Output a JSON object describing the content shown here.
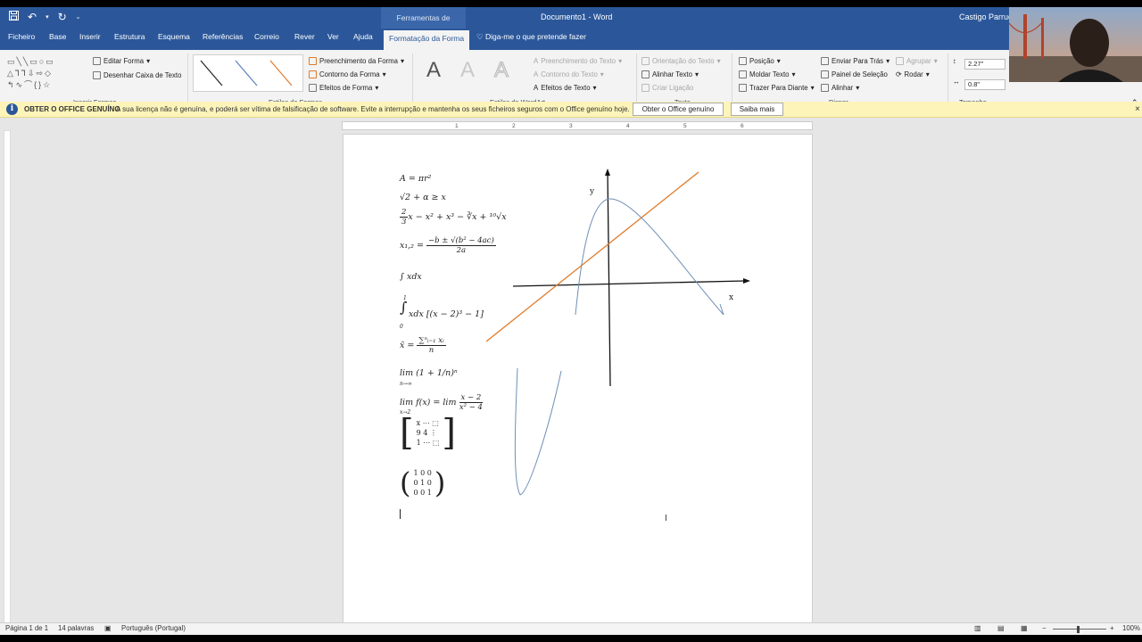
{
  "title_bar": {
    "contextual_header": "Ferramentas de Desenho",
    "document_title": "Documento1 - Word",
    "user_name": "Castigo Parruque"
  },
  "tabs": [
    "Ficheiro",
    "Base",
    "Inserir",
    "Estrutura",
    "Esquema",
    "Referências",
    "Correio",
    "Rever",
    "Ver",
    "Ajuda",
    "Formatação da Forma"
  ],
  "tell_me": "Diga-me o que pretende fazer",
  "ribbon": {
    "insert_shapes": {
      "edit_shape": "Editar Forma",
      "draw_textbox": "Desenhar Caixa de Texto",
      "label": "Inserir Formas"
    },
    "shape_styles": {
      "fill": "Preenchimento da Forma",
      "outline": "Contorno da Forma",
      "effects": "Efeitos de Forma",
      "label": "Estilos de Formas"
    },
    "wordart_styles": {
      "letter": "A",
      "text_fill": "Preenchimento do Texto",
      "text_outline": "Contorno do Texto",
      "text_effects": "Efeitos de Texto",
      "label": "Estilos do WordArt"
    },
    "text": {
      "direction": "Orientação do Texto",
      "align": "Alinhar Texto",
      "link": "Criar Ligação",
      "label": "Texto"
    },
    "arrange": {
      "position": "Posição",
      "wrap": "Moldar Texto",
      "bring_forward": "Trazer Para Diante",
      "send_backward": "Enviar Para Trás",
      "selection_pane": "Painel de Seleção",
      "align": "Alinhar",
      "group": "Agrupar",
      "rotate": "Rodar",
      "label": "Dispor"
    },
    "size": {
      "height": "2.27\"",
      "width": "0.8\"",
      "label": "Tamanho"
    }
  },
  "message_bar": {
    "title": "OBTER O OFFICE GENUÍNO",
    "text": "A sua licença não é genuína, e poderá ser vítima de falsificação de software. Evite a interrupção e mantenha os seus ficheiros seguros com o Office genuíno hoje.",
    "btn_get": "Obter o Office genuíno",
    "btn_more": "Saiba mais",
    "close": "×"
  },
  "ruler_ticks": [
    "1",
    "2",
    "3",
    "4",
    "5",
    "6"
  ],
  "document": {
    "eq1": "A = πr²",
    "eq2": "√2 + α ≥ x",
    "eq3_num": "2",
    "eq3_den": "3",
    "eq3_rest": "x − x² + x³ − ∛x + ¹⁰√x",
    "eq4_lhs": "x₁,₂ =",
    "eq4_num": "−b ± √(b² − 4ac)",
    "eq4_den": "2a",
    "eq5": "∫ xdx",
    "eq6_upper": "1",
    "eq6_lower": "0",
    "eq6_body": "xdx [(x − 2)³ − 1]",
    "eq7_lhs": "x̄ =",
    "eq7_num": "∑ⁿᵢ₌₁ xᵢ",
    "eq7_den": "n",
    "eq8": "lim (1 + 1/n)ⁿ",
    "eq8_sub": "n→∞",
    "eq9_lhs": "lim f(x) = lim",
    "eq9_sub": "x→2",
    "eq9_num": "x − 2",
    "eq9_den": "x² − 4",
    "matrix1": [
      "x   ⋯   ⬚",
      "9   4   ⋮",
      "1   ⋯   ⬚"
    ],
    "matrix2": [
      "1   0   0",
      "0   1   0",
      "0   0   1"
    ],
    "graph_y": "y",
    "graph_x": "x"
  },
  "status_bar": {
    "page": "Página 1 de 1",
    "words": "14 palavras",
    "language": "Português (Portugal)",
    "zoom": "100%"
  },
  "colors": {
    "word_blue": "#2b579a",
    "orange_line": "#e07b2a",
    "curve_blue": "#6f8fb5",
    "msgbar": "#fcf4b9"
  }
}
